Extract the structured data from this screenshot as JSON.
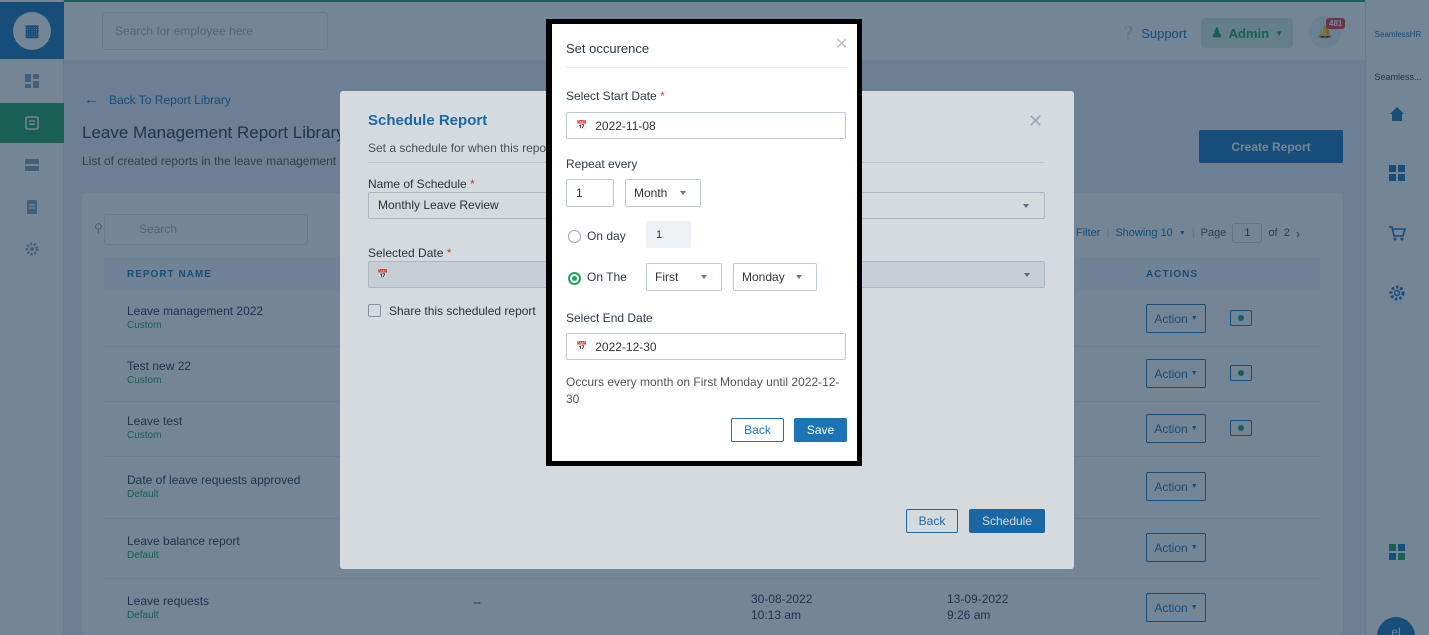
{
  "topbar": {
    "search_placeholder": "Search for employee here",
    "support_label": "Support",
    "admin_label": "Admin",
    "notification_count": "481"
  },
  "leftnav": {
    "icons": [
      "dashboard-icon",
      "reports-icon",
      "table-icon",
      "document-icon",
      "settings-icon"
    ]
  },
  "rightrail": {
    "brand_short": "SeamlessHR",
    "brand_label": "Seamless...",
    "avatar_initials": "el"
  },
  "page": {
    "back_link": "Back To Report Library",
    "title": "Leave Management Report Library",
    "subtitle": "List of created reports in the leave management r",
    "create_button": "Create Report"
  },
  "card": {
    "search_placeholder": "Search",
    "filter_label": "Filter",
    "showing_label": "Showing 10",
    "page_label": "Page",
    "page_value": "1",
    "of_label": "of",
    "total_pages": "2",
    "columns": {
      "report_name": "REPORT NAME",
      "actions": "ACTIONS"
    },
    "rows": [
      {
        "name": "Leave management 2022",
        "type": "Custom",
        "action": "Action"
      },
      {
        "name": "Test new 22",
        "type": "Custom",
        "action": "Action"
      },
      {
        "name": "Leave test",
        "type": "Custom",
        "action": "Action"
      },
      {
        "name": "Date of leave requests approved",
        "type": "Default",
        "action": "Action"
      },
      {
        "name": "Leave balance report",
        "type": "Default",
        "action": "Action"
      },
      {
        "name": "Leave requests",
        "type": "Default",
        "action": "Action",
        "dash": "--",
        "created_date": "30-08-2022",
        "created_time": "10:13 am",
        "updated_date": "13-09-2022",
        "updated_time": "9:26 am"
      }
    ]
  },
  "schedule_modal": {
    "title": "Schedule Report",
    "subtitle": "Set a schedule for when this repor",
    "name_label": "Name of Schedule",
    "name_value": "Monthly Leave Review",
    "date_label": "Selected Date",
    "share_label": "Share this scheduled report",
    "back_button": "Back",
    "schedule_button": "Schedule"
  },
  "occurrence_modal": {
    "title": "Set occurence",
    "start_label": "Select Start Date",
    "start_value": "2022-11-08",
    "repeat_label": "Repeat every",
    "repeat_value": "1",
    "repeat_unit": "Month",
    "on_day_label": "On day",
    "on_day_value": "1",
    "on_the_label": "On The",
    "on_the_ordinal": "First",
    "on_the_weekday": "Monday",
    "end_label": "Select End Date",
    "end_value": "2022-12-30",
    "summary": "Occurs every month on First Monday until 2022-12-30",
    "back_button": "Back",
    "save_button": "Save"
  },
  "colors": {
    "primary": "#1c74b6",
    "success": "#23a35a",
    "danger": "#d9453c"
  }
}
